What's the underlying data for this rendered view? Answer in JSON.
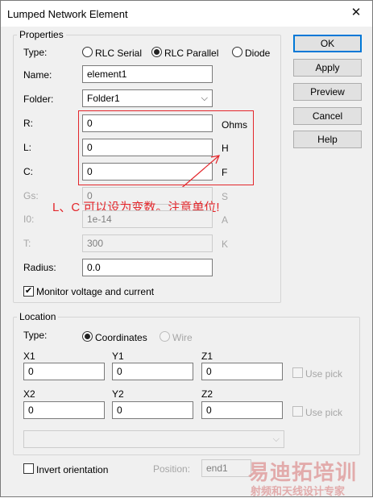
{
  "window": {
    "title": "Lumped Network Element",
    "close_icon": "close-icon"
  },
  "properties": {
    "group_title": "Properties",
    "type_label": "Type:",
    "type_options": [
      "RLC Serial",
      "RLC Parallel",
      "Diode"
    ],
    "type_selected": "RLC Parallel",
    "name_label": "Name:",
    "name_value": "element1",
    "folder_label": "Folder:",
    "folder_value": "Folder1",
    "r_label": "R:",
    "r_value": "0",
    "r_unit": "Ohms",
    "l_label": "L:",
    "l_value": "0",
    "l_unit": "H",
    "c_label": "C:",
    "c_value": "0",
    "c_unit": "F",
    "gs_label": "Gs:",
    "gs_value": "0",
    "gs_unit": "S",
    "i0_label": "I0:",
    "i0_value": "1e-14",
    "i0_unit": "A",
    "t_label": "T:",
    "t_value": "300",
    "t_unit": "K",
    "radius_label": "Radius:",
    "radius_value": "0.0",
    "monitor_label": "Monitor voltage and current",
    "monitor_checked": true
  },
  "annotation": {
    "text": "L、C 可以设为变数。注意单位!",
    "color": "#e3262b"
  },
  "buttons": {
    "ok": "OK",
    "apply": "Apply",
    "preview": "Preview",
    "cancel": "Cancel",
    "help": "Help"
  },
  "location": {
    "group_title": "Location",
    "type_label": "Type:",
    "coordinates_label": "Coordinates",
    "wire_label": "Wire",
    "x1_label": "X1",
    "x1_value": "0",
    "y1_label": "Y1",
    "y1_value": "0",
    "z1_label": "Z1",
    "z1_value": "0",
    "x2_label": "X2",
    "x2_value": "0",
    "y2_label": "Y2",
    "y2_value": "0",
    "z2_label": "Z2",
    "z2_value": "0",
    "use_pick_1": "Use pick",
    "use_pick_2": "Use pick",
    "dropdown_value": ""
  },
  "bottom": {
    "invert_label": "Invert orientation",
    "position_label": "Position:",
    "position_value": "end1"
  },
  "watermark": {
    "line1": "易迪拓培训",
    "line2": "射频和天线设计专家"
  }
}
